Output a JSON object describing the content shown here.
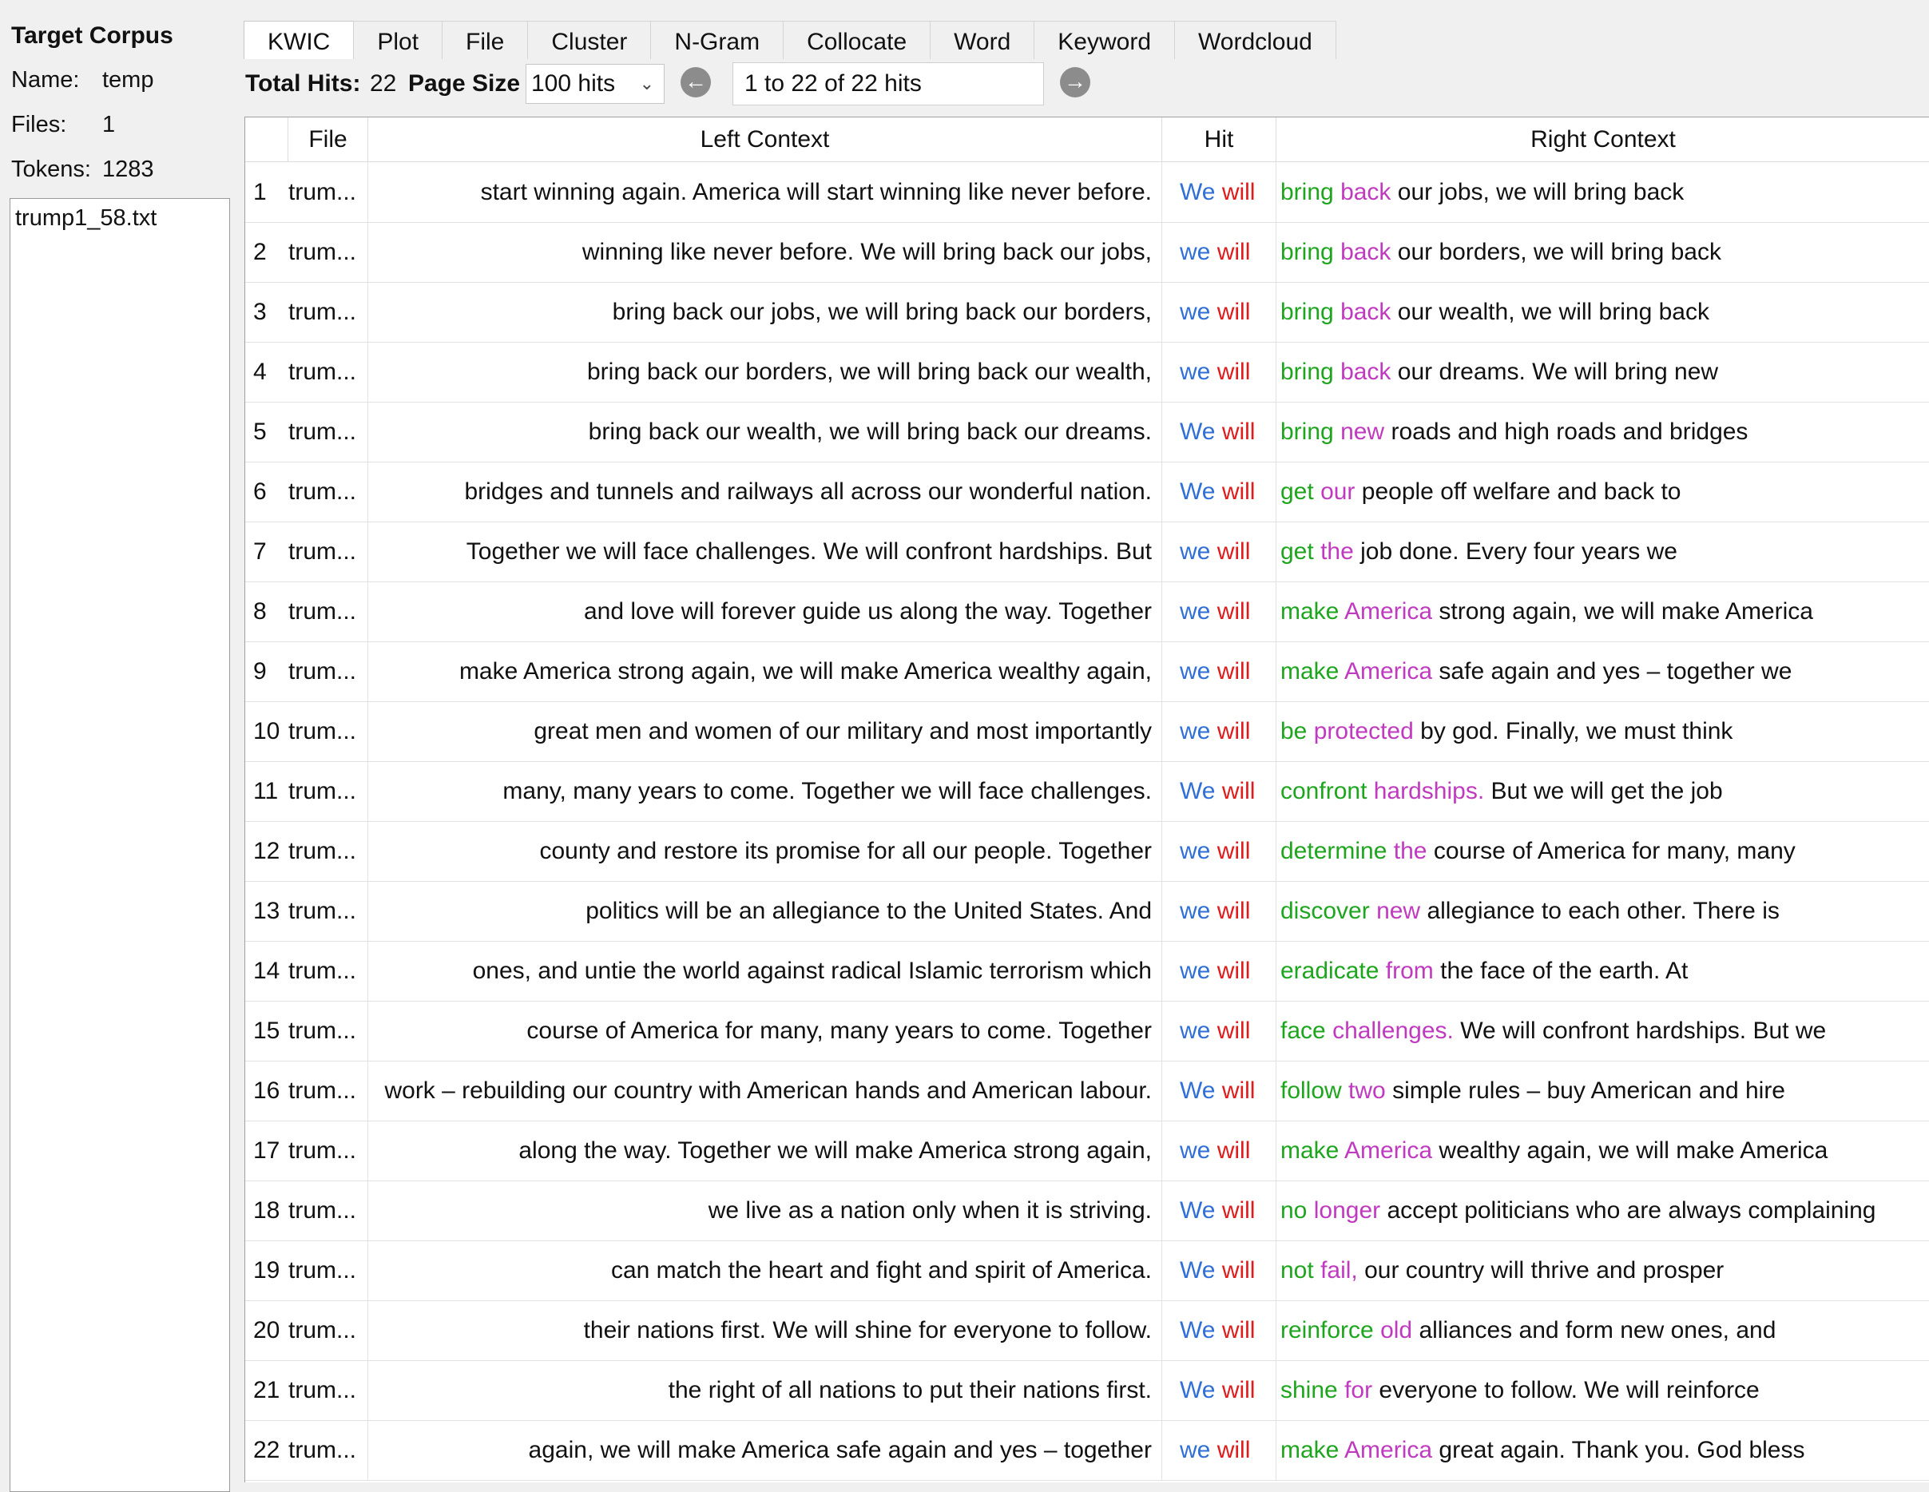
{
  "corpus": {
    "title": "Target Corpus",
    "name_label": "Name:",
    "name_value": "temp",
    "files_label": "Files:",
    "files_value": "1",
    "tokens_label": "Tokens:",
    "tokens_value": "1283",
    "file_list": [
      "trump1_58.txt"
    ]
  },
  "tabs": [
    "KWIC",
    "Plot",
    "File",
    "Cluster",
    "N-Gram",
    "Collocate",
    "Word",
    "Keyword",
    "Wordcloud"
  ],
  "active_tab": "KWIC",
  "toolbar": {
    "total_hits_label": "Total Hits:",
    "total_hits_value": "22",
    "page_size_label": "Page Size",
    "page_size_value": "100 hits",
    "hits_range": "1 to 22 of 22 hits",
    "prev_icon": "arrow-left-circle-icon",
    "next_icon": "arrow-right-circle-icon"
  },
  "table": {
    "headers": {
      "num": "",
      "file": "File",
      "left": "Left Context",
      "hit": "Hit",
      "right": "Right Context"
    },
    "colors": {
      "hit1": "#2f6fd6",
      "hit2": "#e01b1b",
      "r1": "#1ea51e",
      "r2": "#c03ac0"
    },
    "rows": [
      {
        "num": "1",
        "file": "trum...",
        "left": "start winning again. America will start winning like never before.",
        "hit1": "We",
        "hit2": "will",
        "r1": "bring",
        "r2": "back",
        "rest": "our jobs, we will bring back"
      },
      {
        "num": "2",
        "file": "trum...",
        "left": "winning like never before. We will bring back our jobs,",
        "hit1": "we",
        "hit2": "will",
        "r1": "bring",
        "r2": "back",
        "rest": "our borders, we will bring back"
      },
      {
        "num": "3",
        "file": "trum...",
        "left": "bring back our jobs, we will bring back our borders,",
        "hit1": "we",
        "hit2": "will",
        "r1": "bring",
        "r2": "back",
        "rest": "our wealth, we will bring back"
      },
      {
        "num": "4",
        "file": "trum...",
        "left": "bring back our borders, we will bring back our wealth,",
        "hit1": "we",
        "hit2": "will",
        "r1": "bring",
        "r2": "back",
        "rest": "our dreams. We will bring new"
      },
      {
        "num": "5",
        "file": "trum...",
        "left": "bring back our wealth, we will bring back our dreams.",
        "hit1": "We",
        "hit2": "will",
        "r1": "bring",
        "r2": "new",
        "rest": "roads and high roads and bridges"
      },
      {
        "num": "6",
        "file": "trum...",
        "left": "bridges and tunnels and railways all across our wonderful nation.",
        "hit1": "We",
        "hit2": "will",
        "r1": "get",
        "r2": "our",
        "rest": "people off welfare and back to"
      },
      {
        "num": "7",
        "file": "trum...",
        "left": "Together we will face challenges. We will confront hardships. But",
        "hit1": "we",
        "hit2": "will",
        "r1": "get",
        "r2": "the",
        "rest": "job done. Every four years we"
      },
      {
        "num": "8",
        "file": "trum...",
        "left": "and love will forever guide us along the way. Together",
        "hit1": "we",
        "hit2": "will",
        "r1": "make",
        "r2": "America",
        "rest": "strong again, we will make America"
      },
      {
        "num": "9",
        "file": "trum...",
        "left": "make America strong again, we will make America wealthy again,",
        "hit1": "we",
        "hit2": "will",
        "r1": "make",
        "r2": "America",
        "rest": "safe again and yes – together we"
      },
      {
        "num": "10",
        "file": "trum...",
        "left": "great men and women of our military and most importantly",
        "hit1": "we",
        "hit2": "will",
        "r1": "be",
        "r2": "protected",
        "rest": "by god. Finally, we must think"
      },
      {
        "num": "11",
        "file": "trum...",
        "left": "many, many years to come. Together we will face challenges.",
        "hit1": "We",
        "hit2": "will",
        "r1": "confront",
        "r2": "hardships.",
        "rest": "But we will get the job"
      },
      {
        "num": "12",
        "file": "trum...",
        "left": "county and restore its promise for all our people. Together",
        "hit1": "we",
        "hit2": "will",
        "r1": "determine",
        "r2": "the",
        "rest": "course of America for many, many"
      },
      {
        "num": "13",
        "file": "trum...",
        "left": "politics will be an allegiance to the United States. And",
        "hit1": "we",
        "hit2": "will",
        "r1": "discover",
        "r2": "new",
        "rest": "allegiance to each other. There is"
      },
      {
        "num": "14",
        "file": "trum...",
        "left": "ones, and untie the world against radical Islamic terrorism which",
        "hit1": "we",
        "hit2": "will",
        "r1": "eradicate",
        "r2": "from",
        "rest": "the face of the earth. At"
      },
      {
        "num": "15",
        "file": "trum...",
        "left": "course of America for many, many years to come. Together",
        "hit1": "we",
        "hit2": "will",
        "r1": "face",
        "r2": "challenges.",
        "rest": "We will confront hardships. But we"
      },
      {
        "num": "16",
        "file": "trum...",
        "left": "work – rebuilding our country with American hands and American labour.",
        "hit1": "We",
        "hit2": "will",
        "r1": "follow",
        "r2": "two",
        "rest": "simple rules – buy American and hire"
      },
      {
        "num": "17",
        "file": "trum...",
        "left": "along the way. Together we will make America strong again,",
        "hit1": "we",
        "hit2": "will",
        "r1": "make",
        "r2": "America",
        "rest": "wealthy again, we will make America"
      },
      {
        "num": "18",
        "file": "trum...",
        "left": "we live as a nation only when it is striving.",
        "hit1": "We",
        "hit2": "will",
        "r1": "no",
        "r2": "longer",
        "rest": "accept politicians who are always complaining"
      },
      {
        "num": "19",
        "file": "trum...",
        "left": "can match the heart and fight and spirit of America.",
        "hit1": "We",
        "hit2": "will",
        "r1": "not",
        "r2": "fail,",
        "rest": "our country will thrive and prosper"
      },
      {
        "num": "20",
        "file": "trum...",
        "left": "their nations first. We will shine for everyone to follow.",
        "hit1": "We",
        "hit2": "will",
        "r1": "reinforce",
        "r2": "old",
        "rest": "alliances and form new ones, and"
      },
      {
        "num": "21",
        "file": "trum...",
        "left": "the right of all nations to put their nations first.",
        "hit1": "We",
        "hit2": "will",
        "r1": "shine",
        "r2": "for",
        "rest": "everyone to follow. We will reinforce"
      },
      {
        "num": "22",
        "file": "trum...",
        "left": "again, we will make America safe again and yes – together",
        "hit1": "we",
        "hit2": "will",
        "r1": "make",
        "r2": "America",
        "rest": "great again. Thank you. God bless"
      }
    ]
  }
}
